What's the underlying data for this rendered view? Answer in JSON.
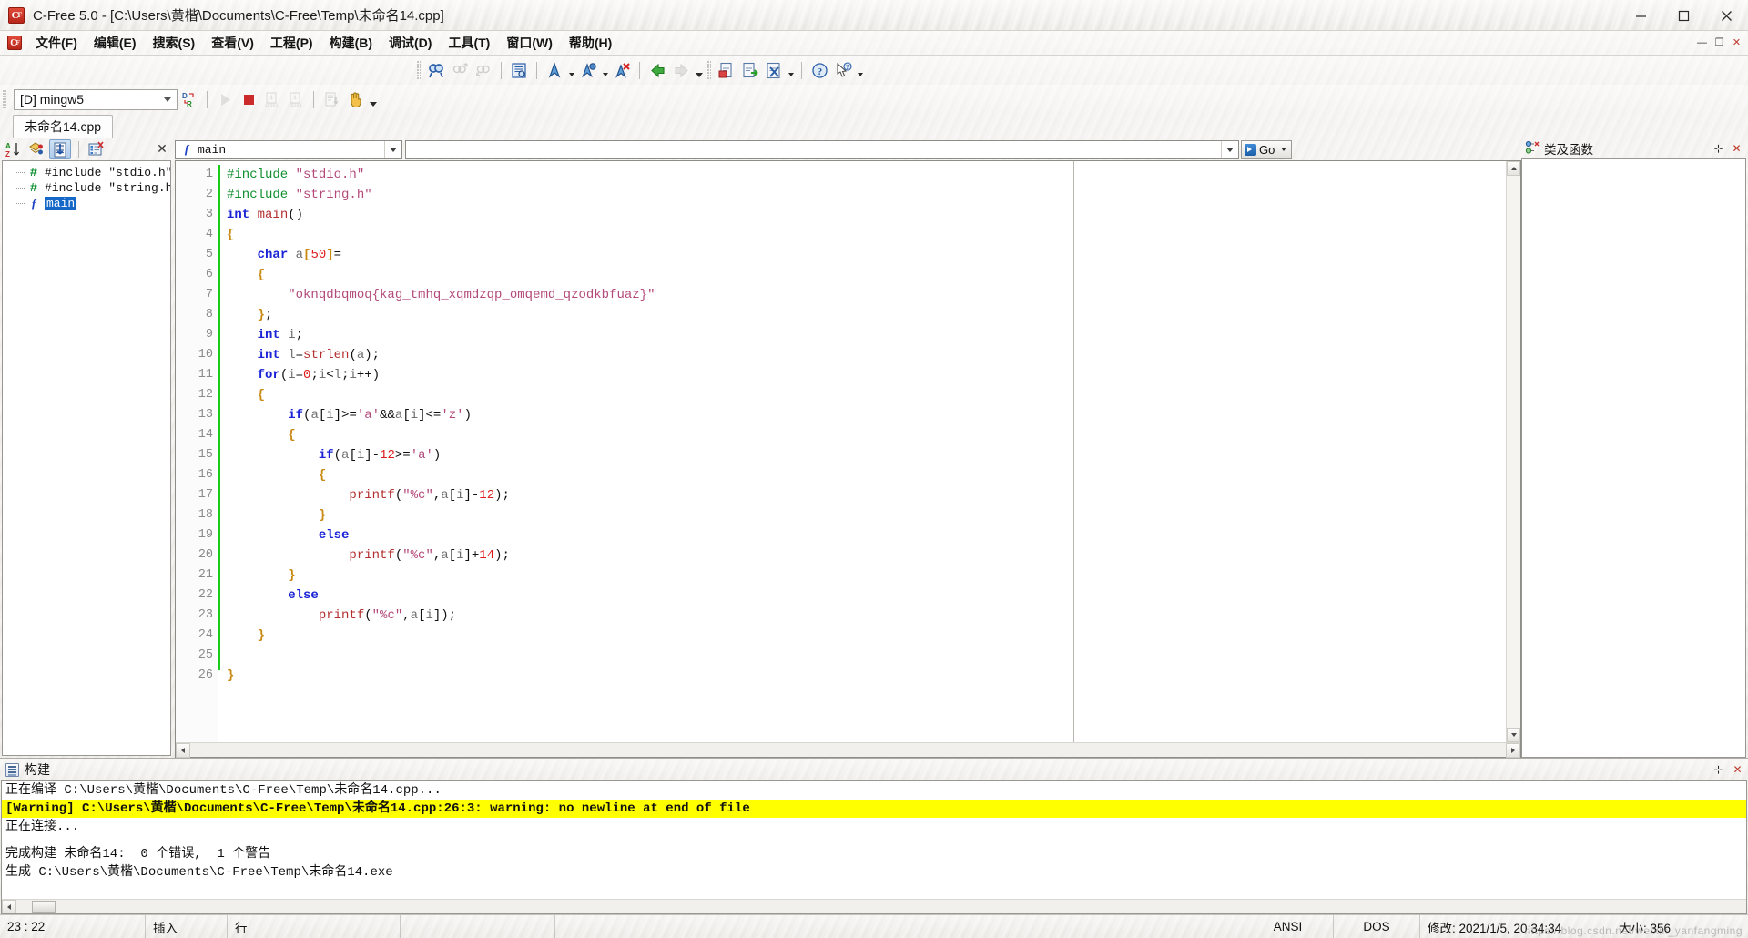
{
  "window": {
    "title": "C-Free 5.0 - [C:\\Users\\黄楷\\Documents\\C-Free\\Temp\\未命名14.cpp]",
    "app_icon": "c-free-logo-icon",
    "minimize_label": "最小化",
    "maximize_label": "最大化",
    "close_label": "关闭"
  },
  "menubar": {
    "items": [
      {
        "label": "文件(F)"
      },
      {
        "label": "编辑(E)"
      },
      {
        "label": "搜索(S)"
      },
      {
        "label": "查看(V)"
      },
      {
        "label": "工程(P)"
      },
      {
        "label": "构建(B)"
      },
      {
        "label": "调试(D)"
      },
      {
        "label": "工具(T)"
      },
      {
        "label": "窗口(W)"
      },
      {
        "label": "帮助(H)"
      }
    ],
    "mdi_buttons": [
      {
        "name": "mdi-minimize",
        "glyph": "—"
      },
      {
        "name": "mdi-restore",
        "glyph": "❐"
      },
      {
        "name": "mdi-close",
        "glyph": "✕"
      }
    ]
  },
  "toolbar_search": {
    "buttons": [
      {
        "name": "find-icon",
        "label": "查找",
        "glyph": "find",
        "disabled": false
      },
      {
        "name": "find-previous-icon",
        "label": "查找上一个",
        "glyph": "find-prev",
        "disabled": true
      },
      {
        "name": "find-next-icon",
        "label": "查找下一个",
        "glyph": "find-next",
        "disabled": true
      },
      {
        "name": "replace-icon",
        "label": "替换",
        "glyph": "replace",
        "disabled": false
      },
      {
        "name": "bookmark-toggle-icon",
        "label": "切换书签",
        "glyph": "bookmark",
        "disabled": false
      },
      {
        "name": "bookmark-next-icon",
        "label": "下一个书签",
        "glyph": "bookmark-next",
        "disabled": false
      },
      {
        "name": "bookmark-clear-icon",
        "label": "清除书签",
        "glyph": "bookmark-clear",
        "disabled": false
      },
      {
        "name": "navigate-back-icon",
        "label": "后退",
        "glyph": "back",
        "disabled": false
      },
      {
        "name": "navigate-forward-icon",
        "label": "前进",
        "glyph": "forward",
        "disabled": true
      },
      {
        "name": "compile-file-icon",
        "label": "编译",
        "glyph": "compile",
        "disabled": false
      },
      {
        "name": "build-run-icon",
        "label": "构建运行",
        "glyph": "build-run",
        "disabled": false
      },
      {
        "name": "stop-build-icon",
        "label": "停止构建",
        "glyph": "stop-build",
        "disabled": false
      }
    ]
  },
  "toolbar_build": {
    "compiler": {
      "value": "[D] mingw5",
      "placeholder": "选择编译器"
    },
    "buttons": [
      {
        "name": "debug-release-toggle-icon",
        "label": "Debug/Release",
        "glyph": "dr",
        "disabled": false
      },
      {
        "name": "run-icon",
        "label": "运行",
        "glyph": "run",
        "disabled": true
      },
      {
        "name": "stop-icon",
        "label": "停止",
        "glyph": "stop",
        "disabled": false
      },
      {
        "name": "step-into-icon",
        "label": "单步进入",
        "glyph": "step-into",
        "disabled": true
      },
      {
        "name": "step-over-icon",
        "label": "单步跳过",
        "glyph": "step-over",
        "disabled": true
      },
      {
        "name": "show-output-icon",
        "label": "显示输出",
        "glyph": "output",
        "disabled": true
      },
      {
        "name": "pause-hand-icon",
        "label": "中断",
        "glyph": "hand",
        "disabled": false
      }
    ]
  },
  "document_tabs": [
    {
      "label": "未命名14.cpp",
      "active": true
    }
  ],
  "left_panel": {
    "toolbar_buttons": [
      {
        "name": "sort-alpha-icon",
        "label": "按字母排序",
        "active": false
      },
      {
        "name": "group-by-type-icon",
        "label": "按类型分组",
        "active": false
      },
      {
        "name": "sort-by-position-icon",
        "label": "按位置排序",
        "active": true
      },
      {
        "name": "filter-symbols-icon",
        "label": "筛选符号",
        "active": false
      }
    ],
    "close_label": "✕",
    "tree": [
      {
        "icon": "preprocessor-icon",
        "glyph": "#",
        "label": "#include \"stdio.h\"",
        "selected": false,
        "last": false
      },
      {
        "icon": "preprocessor-icon",
        "glyph": "#",
        "label": "#include \"string.h\"",
        "selected": false,
        "last": false
      },
      {
        "icon": "function-icon",
        "glyph": "f",
        "label": "main",
        "selected": true,
        "last": true
      }
    ]
  },
  "editor": {
    "symbol_combo": {
      "value": "main",
      "icon": "function-icon",
      "glyph": "f"
    },
    "find_field": {
      "value": "",
      "placeholder": ""
    },
    "go_button": {
      "label": "Go",
      "icon": "go-arrow-icon"
    },
    "modified_marker_color": "#19cc19",
    "lines": [
      {
        "n": 1,
        "tokens": [
          {
            "t": "pre",
            "v": "#include"
          },
          {
            "t": "plain",
            "v": " "
          },
          {
            "t": "str",
            "v": "\"stdio.h\""
          }
        ]
      },
      {
        "n": 2,
        "tokens": [
          {
            "t": "pre",
            "v": "#include"
          },
          {
            "t": "plain",
            "v": " "
          },
          {
            "t": "str",
            "v": "\"string.h\""
          }
        ]
      },
      {
        "n": 3,
        "tokens": [
          {
            "t": "kw",
            "v": "int"
          },
          {
            "t": "plain",
            "v": " "
          },
          {
            "t": "fn",
            "v": "main"
          },
          {
            "t": "plain",
            "v": "()"
          }
        ]
      },
      {
        "n": 4,
        "tokens": [
          {
            "t": "brace",
            "v": "{"
          }
        ]
      },
      {
        "n": 5,
        "tokens": [
          {
            "t": "plain",
            "v": "    "
          },
          {
            "t": "kw",
            "v": "char"
          },
          {
            "t": "plain",
            "v": " "
          },
          {
            "t": "id",
            "v": "a"
          },
          {
            "t": "brace",
            "v": "["
          },
          {
            "t": "num",
            "v": "50"
          },
          {
            "t": "brace",
            "v": "]"
          },
          {
            "t": "plain",
            "v": "="
          }
        ]
      },
      {
        "n": 6,
        "tokens": [
          {
            "t": "plain",
            "v": "    "
          },
          {
            "t": "brace",
            "v": "{"
          }
        ]
      },
      {
        "n": 7,
        "tokens": [
          {
            "t": "plain",
            "v": "        "
          },
          {
            "t": "str",
            "v": "\"oknqdbqmoq{kag_tmhq_xqmdzqp_omqemd_qzodkbfuaz}\""
          }
        ]
      },
      {
        "n": 8,
        "tokens": [
          {
            "t": "plain",
            "v": "    "
          },
          {
            "t": "brace",
            "v": "}"
          },
          {
            "t": "plain",
            "v": ";"
          }
        ]
      },
      {
        "n": 9,
        "tokens": [
          {
            "t": "plain",
            "v": "    "
          },
          {
            "t": "kw",
            "v": "int"
          },
          {
            "t": "plain",
            "v": " "
          },
          {
            "t": "id",
            "v": "i"
          },
          {
            "t": "plain",
            "v": ";"
          }
        ]
      },
      {
        "n": 10,
        "tokens": [
          {
            "t": "plain",
            "v": "    "
          },
          {
            "t": "kw",
            "v": "int"
          },
          {
            "t": "plain",
            "v": " "
          },
          {
            "t": "id",
            "v": "l"
          },
          {
            "t": "plain",
            "v": "="
          },
          {
            "t": "fn",
            "v": "strlen"
          },
          {
            "t": "plain",
            "v": "("
          },
          {
            "t": "id",
            "v": "a"
          },
          {
            "t": "plain",
            "v": ");"
          }
        ]
      },
      {
        "n": 11,
        "tokens": [
          {
            "t": "plain",
            "v": "    "
          },
          {
            "t": "kw",
            "v": "for"
          },
          {
            "t": "plain",
            "v": "("
          },
          {
            "t": "id",
            "v": "i"
          },
          {
            "t": "plain",
            "v": "="
          },
          {
            "t": "num",
            "v": "0"
          },
          {
            "t": "plain",
            "v": ";"
          },
          {
            "t": "id",
            "v": "i"
          },
          {
            "t": "plain",
            "v": "<"
          },
          {
            "t": "id",
            "v": "l"
          },
          {
            "t": "plain",
            "v": ";"
          },
          {
            "t": "id",
            "v": "i"
          },
          {
            "t": "plain",
            "v": "++)"
          }
        ]
      },
      {
        "n": 12,
        "tokens": [
          {
            "t": "plain",
            "v": "    "
          },
          {
            "t": "brace",
            "v": "{"
          }
        ]
      },
      {
        "n": 13,
        "tokens": [
          {
            "t": "plain",
            "v": "        "
          },
          {
            "t": "kw",
            "v": "if"
          },
          {
            "t": "plain",
            "v": "("
          },
          {
            "t": "id",
            "v": "a"
          },
          {
            "t": "plain",
            "v": "["
          },
          {
            "t": "id",
            "v": "i"
          },
          {
            "t": "plain",
            "v": "]>="
          },
          {
            "t": "chr",
            "v": "'a'"
          },
          {
            "t": "plain",
            "v": "&&"
          },
          {
            "t": "id",
            "v": "a"
          },
          {
            "t": "plain",
            "v": "["
          },
          {
            "t": "id",
            "v": "i"
          },
          {
            "t": "plain",
            "v": "]<="
          },
          {
            "t": "chr",
            "v": "'z'"
          },
          {
            "t": "plain",
            "v": ")"
          }
        ]
      },
      {
        "n": 14,
        "tokens": [
          {
            "t": "plain",
            "v": "        "
          },
          {
            "t": "brace",
            "v": "{"
          }
        ]
      },
      {
        "n": 15,
        "tokens": [
          {
            "t": "plain",
            "v": "            "
          },
          {
            "t": "kw",
            "v": "if"
          },
          {
            "t": "plain",
            "v": "("
          },
          {
            "t": "id",
            "v": "a"
          },
          {
            "t": "plain",
            "v": "["
          },
          {
            "t": "id",
            "v": "i"
          },
          {
            "t": "plain",
            "v": "]-"
          },
          {
            "t": "num",
            "v": "12"
          },
          {
            "t": "plain",
            "v": ">="
          },
          {
            "t": "chr",
            "v": "'a'"
          },
          {
            "t": "plain",
            "v": ")"
          }
        ]
      },
      {
        "n": 16,
        "tokens": [
          {
            "t": "plain",
            "v": "            "
          },
          {
            "t": "brace",
            "v": "{"
          }
        ]
      },
      {
        "n": 17,
        "tokens": [
          {
            "t": "plain",
            "v": "                "
          },
          {
            "t": "fn",
            "v": "printf"
          },
          {
            "t": "plain",
            "v": "("
          },
          {
            "t": "str",
            "v": "\"%c\""
          },
          {
            "t": "plain",
            "v": ","
          },
          {
            "t": "id",
            "v": "a"
          },
          {
            "t": "plain",
            "v": "["
          },
          {
            "t": "id",
            "v": "i"
          },
          {
            "t": "plain",
            "v": "]-"
          },
          {
            "t": "num",
            "v": "12"
          },
          {
            "t": "plain",
            "v": ");"
          }
        ]
      },
      {
        "n": 18,
        "tokens": [
          {
            "t": "plain",
            "v": "            "
          },
          {
            "t": "brace",
            "v": "}"
          }
        ]
      },
      {
        "n": 19,
        "tokens": [
          {
            "t": "plain",
            "v": "            "
          },
          {
            "t": "kw",
            "v": "else"
          }
        ]
      },
      {
        "n": 20,
        "tokens": [
          {
            "t": "plain",
            "v": "                "
          },
          {
            "t": "fn",
            "v": "printf"
          },
          {
            "t": "plain",
            "v": "("
          },
          {
            "t": "str",
            "v": "\"%c\""
          },
          {
            "t": "plain",
            "v": ","
          },
          {
            "t": "id",
            "v": "a"
          },
          {
            "t": "plain",
            "v": "["
          },
          {
            "t": "id",
            "v": "i"
          },
          {
            "t": "plain",
            "v": "]+"
          },
          {
            "t": "num",
            "v": "14"
          },
          {
            "t": "plain",
            "v": ");"
          }
        ]
      },
      {
        "n": 21,
        "tokens": [
          {
            "t": "plain",
            "v": "        "
          },
          {
            "t": "brace",
            "v": "}"
          }
        ]
      },
      {
        "n": 22,
        "tokens": [
          {
            "t": "plain",
            "v": "        "
          },
          {
            "t": "kw",
            "v": "else"
          }
        ]
      },
      {
        "n": 23,
        "tokens": [
          {
            "t": "plain",
            "v": "            "
          },
          {
            "t": "fn",
            "v": "printf"
          },
          {
            "t": "plain",
            "v": "("
          },
          {
            "t": "str",
            "v": "\"%c\""
          },
          {
            "t": "plain",
            "v": ","
          },
          {
            "t": "id",
            "v": "a"
          },
          {
            "t": "plain",
            "v": "["
          },
          {
            "t": "id",
            "v": "i"
          },
          {
            "t": "plain",
            "v": "]);"
          }
        ]
      },
      {
        "n": 24,
        "tokens": [
          {
            "t": "plain",
            "v": "    "
          },
          {
            "t": "brace",
            "v": "}"
          }
        ]
      },
      {
        "n": 25,
        "tokens": []
      },
      {
        "n": 26,
        "tokens": [
          {
            "t": "brace",
            "v": "}"
          }
        ]
      }
    ]
  },
  "right_panel": {
    "title": "类及函数",
    "icon": "class-browser-icon",
    "pin_label": "⊹",
    "close_label": "✕"
  },
  "build_panel": {
    "title": "构建",
    "icon": "build-output-icon",
    "pin_label": "⊹",
    "close_label": "✕",
    "lines": [
      {
        "text": "正在编译 C:\\Users\\黄楷\\Documents\\C-Free\\Temp\\未命名14.cpp...",
        "warn": false
      },
      {
        "text": "[Warning] C:\\Users\\黄楷\\Documents\\C-Free\\Temp\\未命名14.cpp:26:3: warning: no newline at end of file",
        "warn": true
      },
      {
        "text": "正在连接...",
        "warn": false
      },
      {
        "text": "",
        "warn": false
      },
      {
        "text": "完成构建 未命名14:  0 个错误,  1 个警告",
        "warn": false
      },
      {
        "text": "生成 C:\\Users\\黄楷\\Documents\\C-Free\\Temp\\未命名14.exe",
        "warn": false
      }
    ]
  },
  "statusbar": {
    "cursor_position": "23 : 22",
    "insert_mode": "插入",
    "line_mode": "行",
    "blank_cell": "",
    "encoding": "ANSI",
    "line_ending": "DOS",
    "modified": "修改: 2021/1/5, 20:34:34",
    "size": "大小: 356",
    "watermark": "https://blog.csdn.net/weixin_yanfangming"
  }
}
